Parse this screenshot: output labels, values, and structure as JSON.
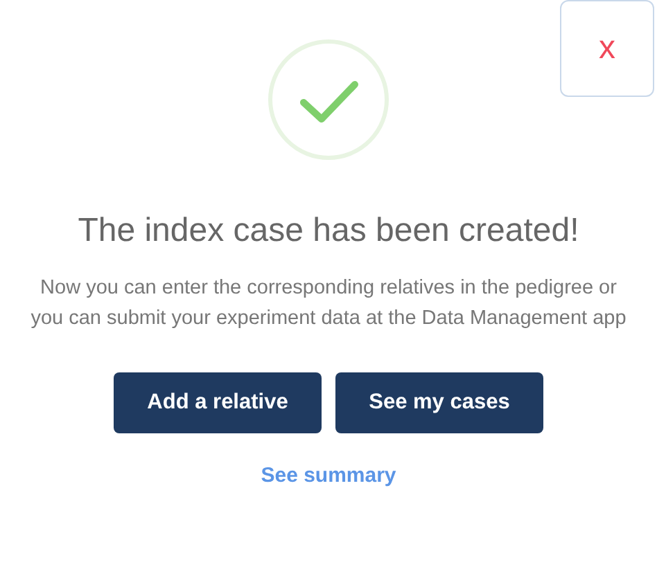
{
  "close_button": {
    "label": "x"
  },
  "title": "The index case has been created!",
  "message": "Now you can enter the corresponding relatives in the pedigree or you can submit your experiment data at the Data Management app",
  "buttons": [
    {
      "label": "Add a relative"
    },
    {
      "label": "See my cases"
    }
  ],
  "link": "See summary"
}
